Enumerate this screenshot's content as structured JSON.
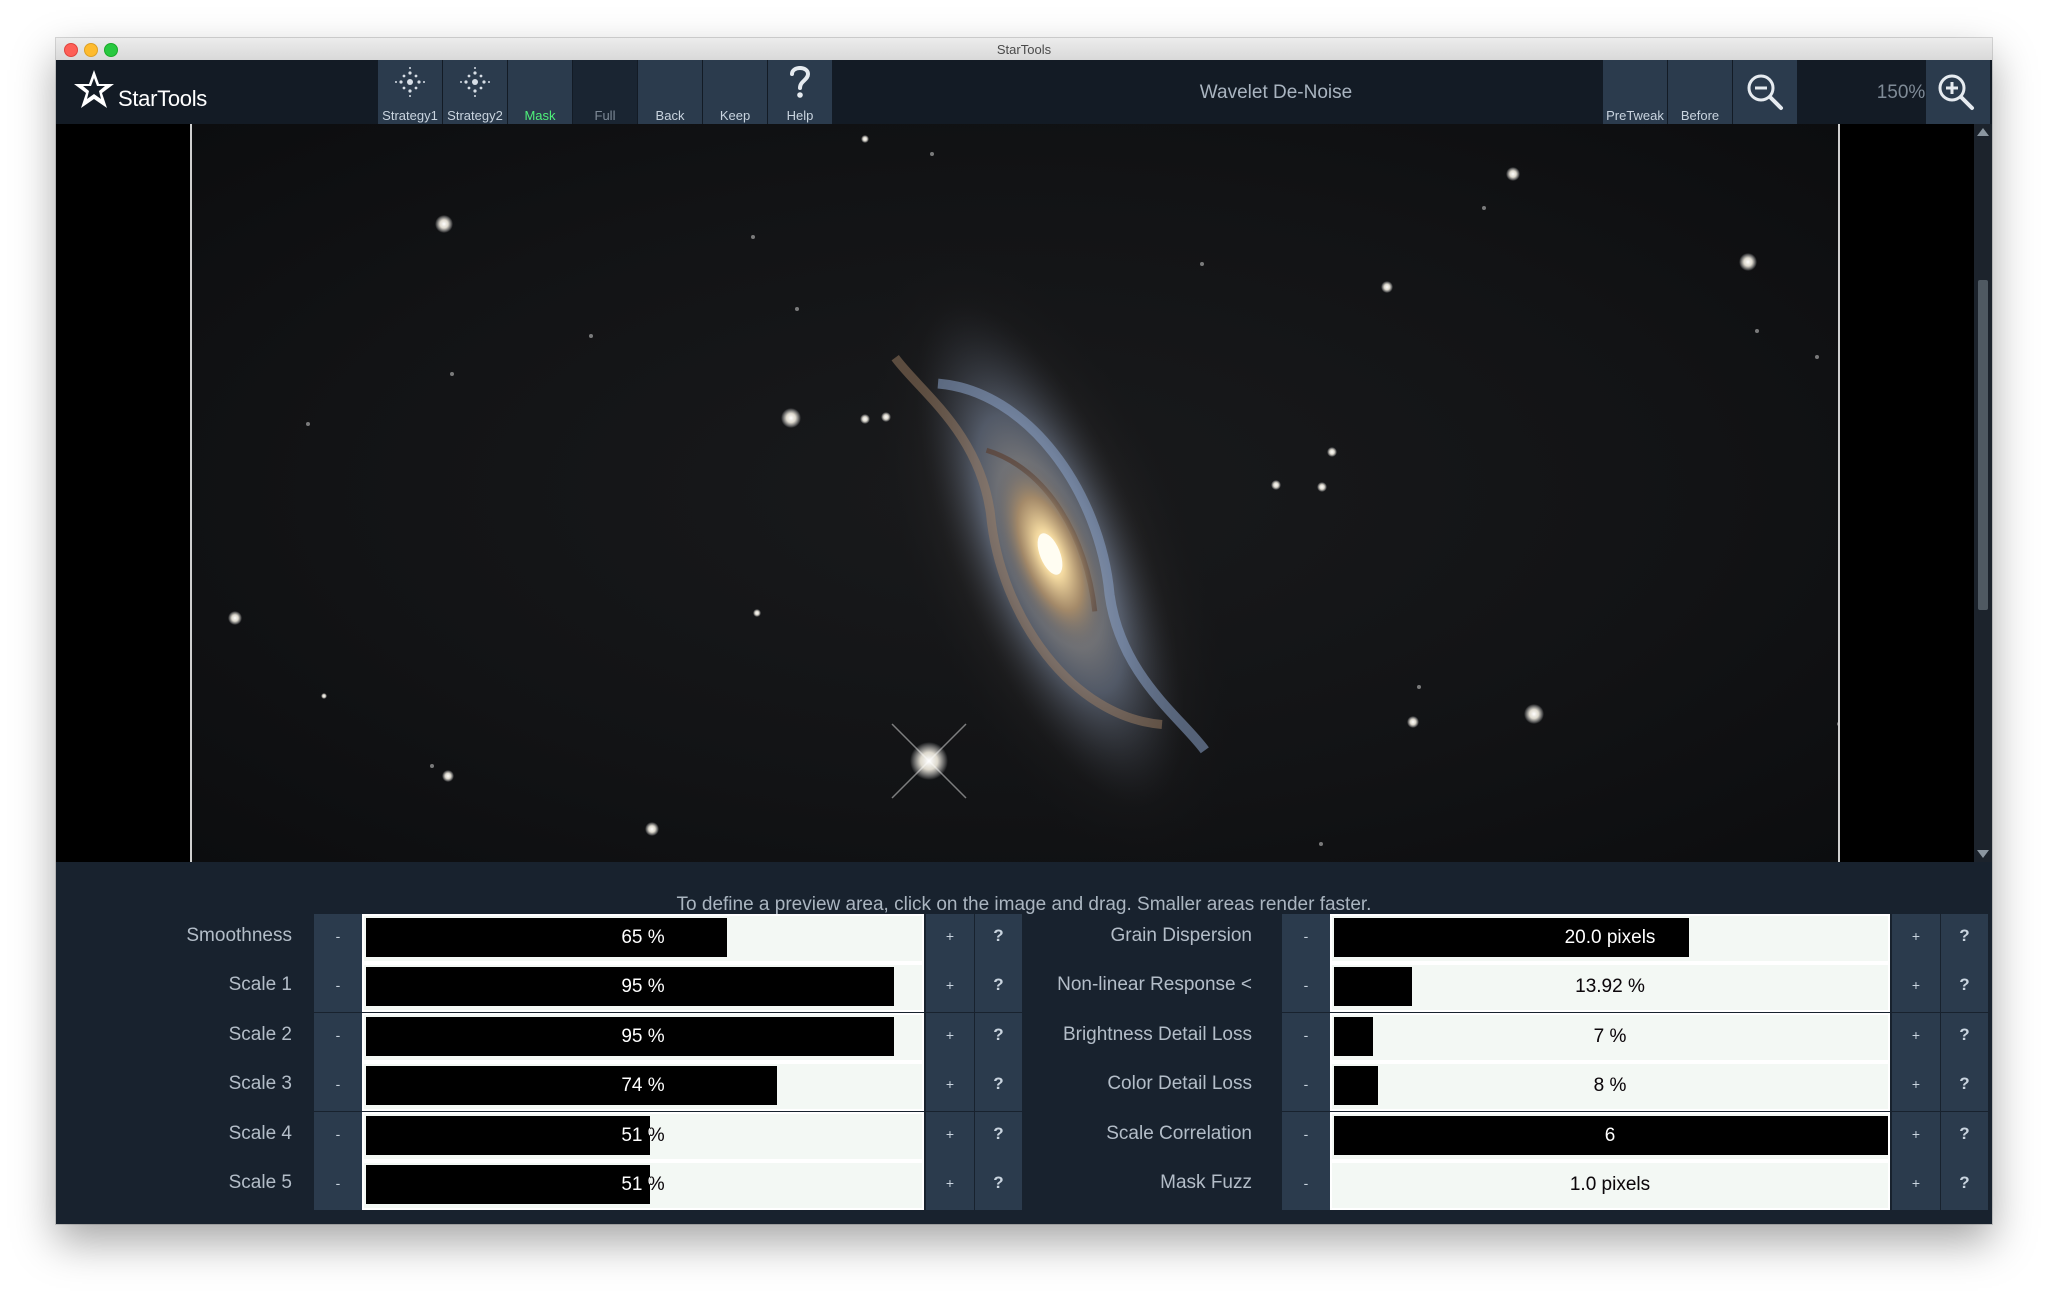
{
  "window": {
    "title": "StarTools"
  },
  "toolbar": {
    "logo_text": "StarTools",
    "buttons": [
      {
        "label": "Strategy1",
        "icon": "sparkle-icon"
      },
      {
        "label": "Strategy2",
        "icon": "sparkle-icon"
      },
      {
        "label": "Mask"
      },
      {
        "label": "Full"
      },
      {
        "label": "Back"
      },
      {
        "label": "Keep"
      },
      {
        "label": "Help",
        "icon": "question-icon"
      }
    ],
    "tool_title": "Wavelet De-Noise",
    "right_buttons": [
      {
        "label": "PreTweak"
      },
      {
        "label": "Before"
      }
    ],
    "zoom_out_icon": "zoom-out-icon",
    "zoom_level": "150%",
    "zoom_in_icon": "zoom-in-icon"
  },
  "panel": {
    "hint": "To define a preview area, click on the image and drag. Smaller areas render faster.",
    "minus": "-",
    "plus": "+",
    "help": "?",
    "left_params": [
      {
        "label": "Smoothness",
        "value": "65 %",
        "fill": 0.65
      },
      {
        "label": "Scale 1",
        "value": "95 %",
        "fill": 0.95
      },
      {
        "label": "Scale 2",
        "value": "95 %",
        "fill": 0.95
      },
      {
        "label": "Scale 3",
        "value": "74 %",
        "fill": 0.74
      },
      {
        "label": "Scale 4",
        "value": "51 %",
        "fill": 0.51
      },
      {
        "label": "Scale 5",
        "value": "51 %",
        "fill": 0.51
      }
    ],
    "right_params": [
      {
        "label": "Grain Dispersion",
        "value": "20.0 pixels",
        "fill": 0.64
      },
      {
        "label": "Non-linear Response <",
        "value": "13.92 %",
        "fill": 0.14
      },
      {
        "label": "Brightness Detail Loss",
        "value": "7 %",
        "fill": 0.07
      },
      {
        "label": "Color Detail Loss",
        "value": "8 %",
        "fill": 0.08
      },
      {
        "label": "Scale Correlation",
        "value": "6",
        "fill": 1.0
      },
      {
        "label": "Mask Fuzz",
        "value": "1.0 pixels",
        "fill": 0.0
      }
    ]
  },
  "colors": {
    "toolbar_bg": "#131b25",
    "button_bg": "#2b3b4d",
    "panel_bg": "#18222e",
    "mask_label": "#4ff07a"
  }
}
